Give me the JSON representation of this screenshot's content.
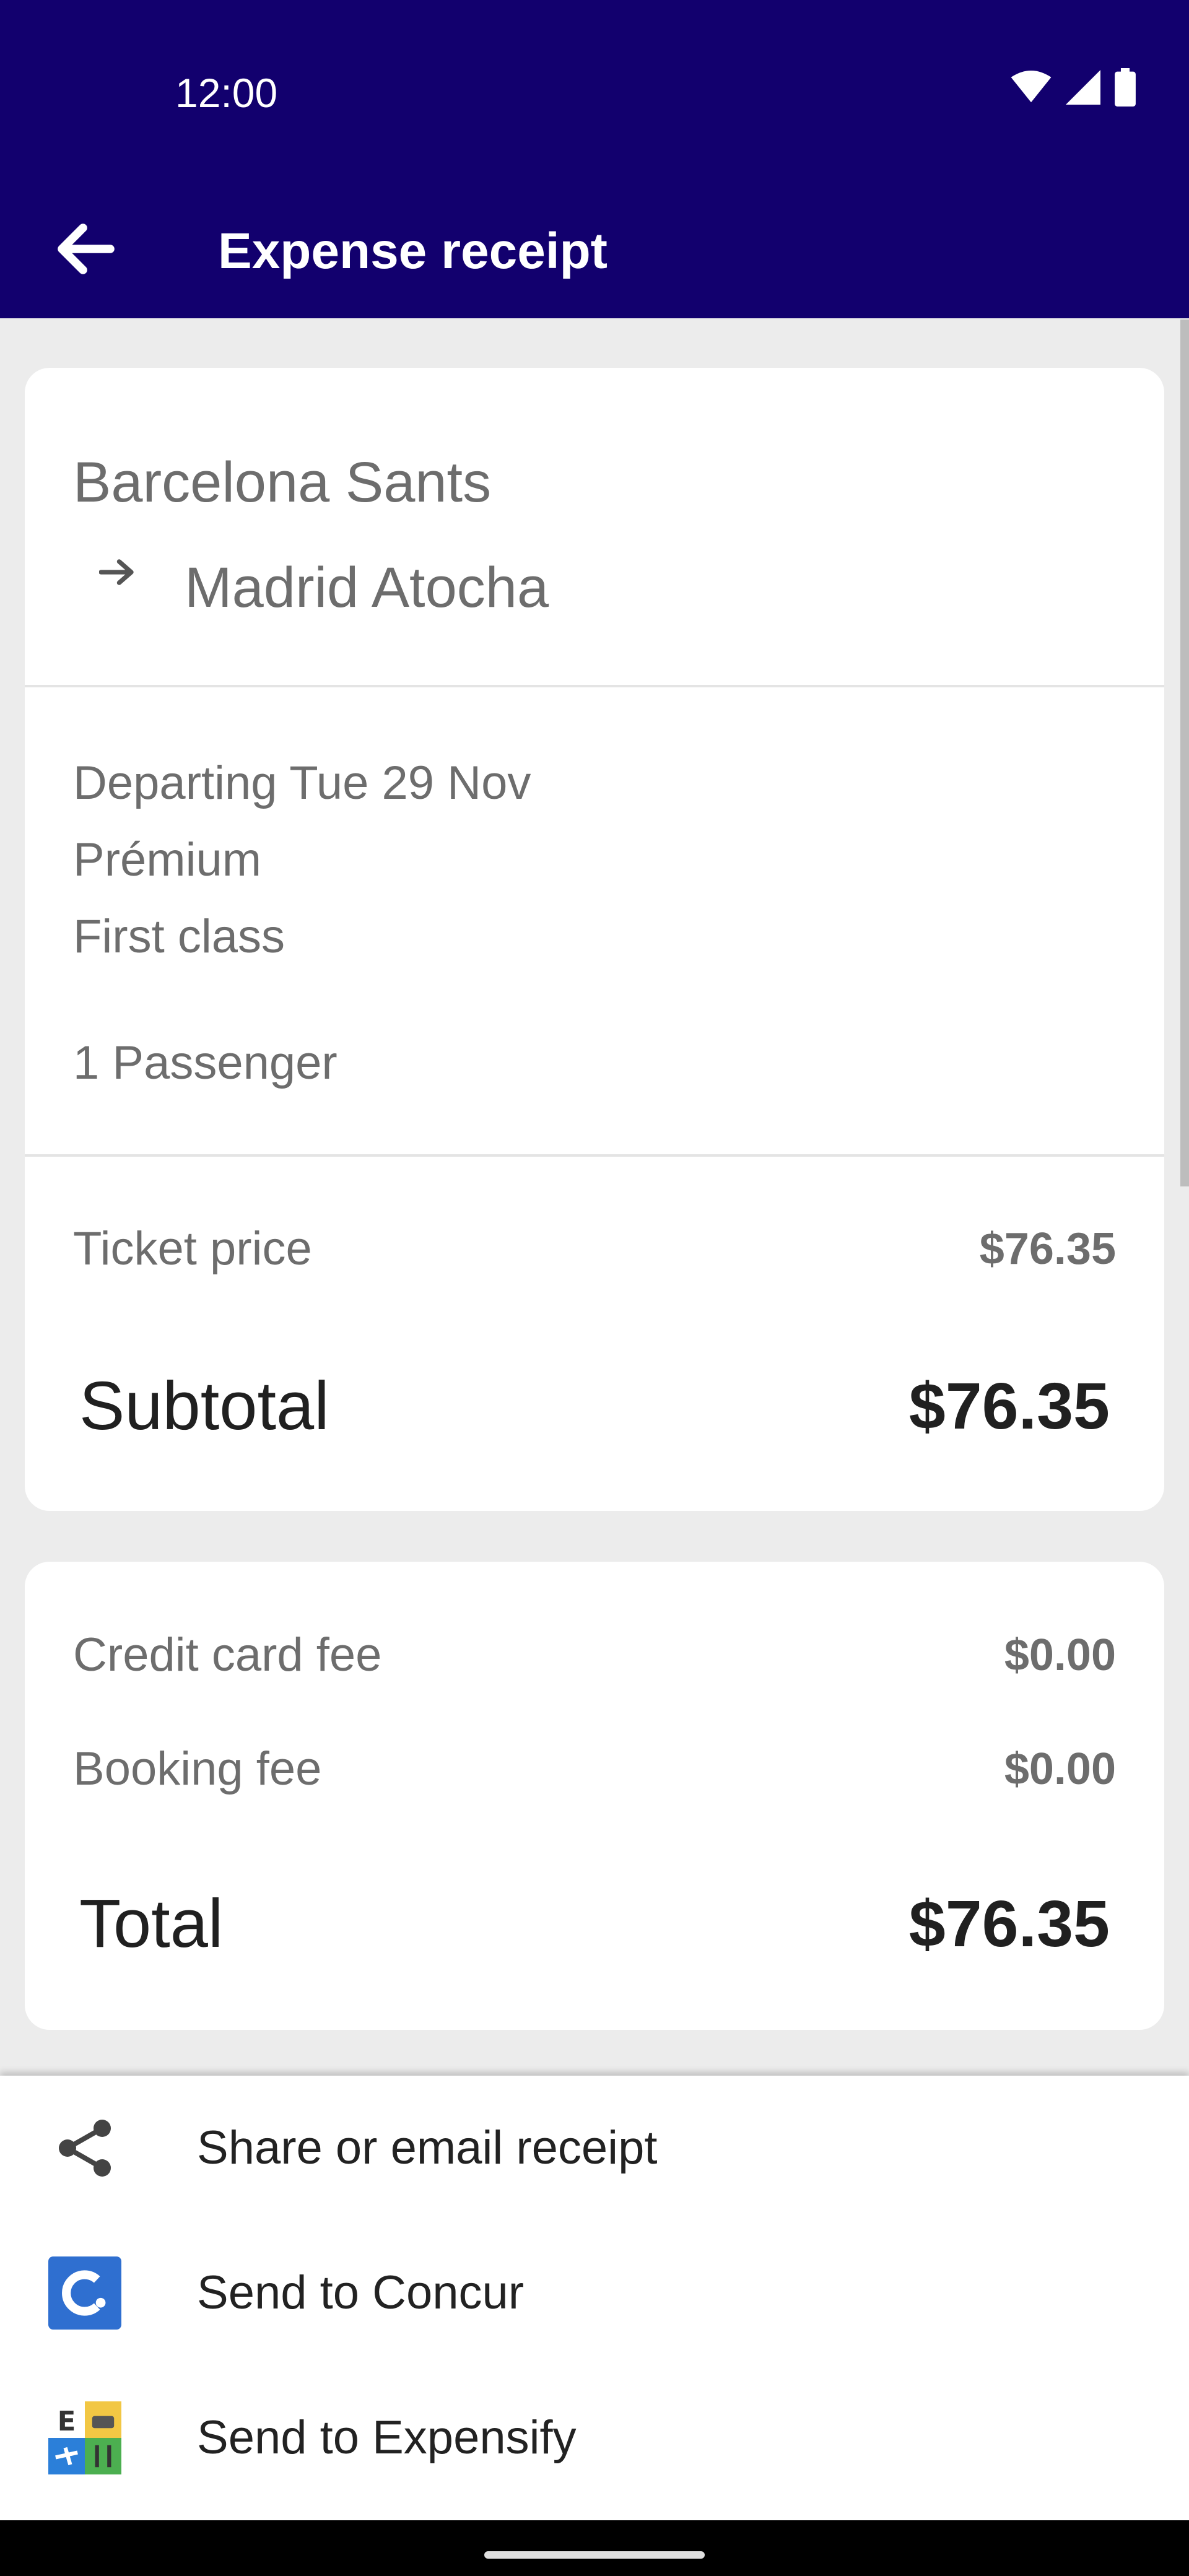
{
  "status_bar": {
    "time": "12:00",
    "icons": [
      "wifi-icon",
      "signal-icon",
      "battery-icon"
    ]
  },
  "app_bar": {
    "title": "Expense receipt",
    "back_icon": "arrow-back-icon"
  },
  "trip": {
    "origin": "Barcelona Sants",
    "destination": "Madrid Atocha",
    "route_icon": "arrow-right-icon",
    "departing": "Departing Tue 29 Nov",
    "fare": "Prémium",
    "class": "First class",
    "passengers": "1 Passenger"
  },
  "pricing": {
    "ticket_price_label": "Ticket price",
    "ticket_price_value": "$76.35",
    "subtotal_label": "Subtotal",
    "subtotal_value": "$76.35"
  },
  "fees": {
    "credit_card_fee_label": "Credit card fee",
    "credit_card_fee_value": "$0.00",
    "booking_fee_label": "Booking fee",
    "booking_fee_value": "$0.00",
    "total_label": "Total",
    "total_value": "$76.35"
  },
  "actions": [
    {
      "label": "Share or email receipt",
      "icon": "share-icon"
    },
    {
      "label": "Send to Concur",
      "icon": "concur-icon"
    },
    {
      "label": "Send to Expensify",
      "icon": "expensify-icon"
    }
  ],
  "colors": {
    "app_bar": "#12006e",
    "background": "#ececec",
    "concur_blue": "#2f6fd0",
    "expensify_yellow": "#f2c744",
    "expensify_blue": "#2b7fd9",
    "expensify_green": "#4caf50"
  }
}
